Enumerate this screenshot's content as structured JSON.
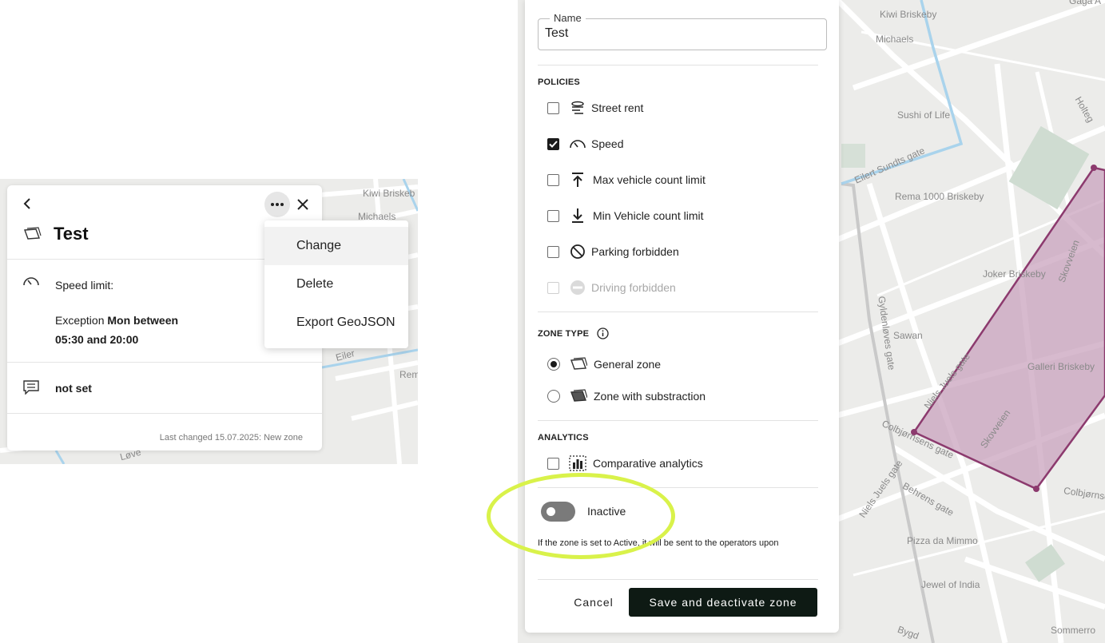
{
  "left_map": {
    "labels": [
      "Kiwi Briskeb",
      "Michaels",
      "Eiler",
      "Rem",
      "Løve"
    ]
  },
  "zone_card": {
    "title": "Test",
    "speed_label": "Speed limit:",
    "exception_prefix": "Exception",
    "exception_days": "Mon between",
    "exception_times": "05:30 and 20:00",
    "comment_value": "not set",
    "last_changed": "Last changed 15.07.2025: New zone"
  },
  "context_menu": {
    "items": [
      "Change",
      "Delete",
      "Export GeoJSON"
    ]
  },
  "edit_panel": {
    "name_label": "Name",
    "name_value": "Test",
    "policies_heading": "POLICIES",
    "policies": [
      {
        "label": "Street rent",
        "checked": false,
        "disabled": false,
        "icon": "street-rent-icon"
      },
      {
        "label": "Speed",
        "checked": true,
        "disabled": false,
        "icon": "speedometer-icon"
      },
      {
        "label": "Max vehicle count limit",
        "checked": false,
        "disabled": false,
        "icon": "arrow-up-to-line-icon"
      },
      {
        "label": "Min Vehicle count limit",
        "checked": false,
        "disabled": false,
        "icon": "arrow-down-to-line-icon"
      },
      {
        "label": "Parking forbidden",
        "checked": false,
        "disabled": false,
        "icon": "no-parking-icon"
      },
      {
        "label": "Driving forbidden",
        "checked": false,
        "disabled": true,
        "icon": "no-entry-icon"
      }
    ],
    "zone_type_heading": "ZONE TYPE",
    "zone_types": [
      {
        "label": "General zone",
        "selected": true,
        "icon": "general-zone-icon"
      },
      {
        "label": "Zone with substraction",
        "selected": false,
        "icon": "substraction-zone-icon"
      }
    ],
    "analytics_heading": "ANALYTICS",
    "analytics": [
      {
        "label": "Comparative analytics",
        "checked": false,
        "icon": "bar-chart-icon"
      }
    ],
    "status_label": "Inactive",
    "status_active": false,
    "hint": "If the zone is set to Active, it will be sent to the operators upon",
    "cancel_label": "Cancel",
    "save_label": "Save and deactivate zone"
  },
  "right_map": {
    "labels": [
      "Kiwi Briskeby",
      "Michaels",
      "Sushi of Life",
      "Eilert Sundts gate",
      "Rema 1000 Briskeby",
      "Joker Briskeby",
      "Skovveien",
      "Sawan",
      "Gyldenløves gate",
      "Galleri Briskeby",
      "Niels Juels gate",
      "Colbjørnsens gate",
      "Behrens gate",
      "Skovveien",
      "Colbjørnsens",
      "Niels Juels gate",
      "Pizza da Mimmo",
      "Jewel of India",
      "Sommerro",
      "Holteg",
      "Bygd",
      "Gaga A"
    ]
  },
  "colors": {
    "zone_fill": "#c9a3bd",
    "zone_stroke": "#8c3a6e",
    "save_button": "#0e1a14",
    "highlight": "#d9f24a",
    "road_blue": "#a9d3ec"
  }
}
